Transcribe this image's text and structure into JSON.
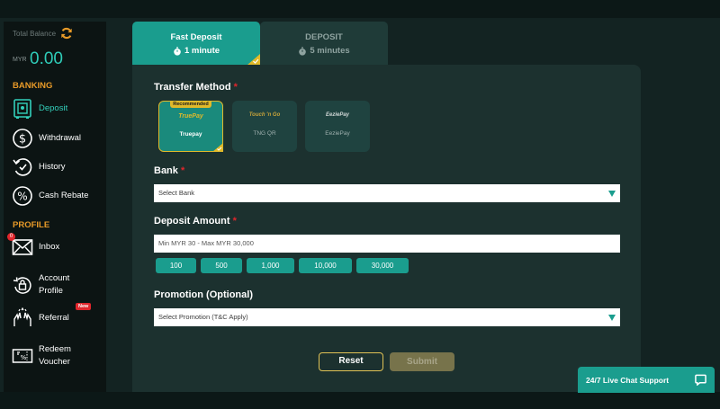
{
  "sidebar": {
    "balance_label": "Total Balance",
    "currency": "MYR",
    "balance": "0.00",
    "banking_title": "BANKING",
    "profile_title": "PROFILE",
    "items": [
      {
        "label": "Deposit",
        "icon": "safe-icon"
      },
      {
        "label": "Withdrawal",
        "icon": "dollar-icon"
      },
      {
        "label": "History",
        "icon": "history-icon"
      },
      {
        "label": "Cash Rebate",
        "icon": "percent-icon"
      },
      {
        "label": "Inbox",
        "icon": "mail-icon",
        "badge": "0"
      },
      {
        "label": "Account Profile",
        "icon": "lock-icon"
      },
      {
        "label": "Referral",
        "icon": "hands-icon",
        "badge": "New"
      },
      {
        "label": "Redeem Voucher",
        "icon": "voucher-icon"
      }
    ]
  },
  "tabs": [
    {
      "name": "Fast Deposit",
      "time": "1 minute"
    },
    {
      "name": "DEPOSIT",
      "time": "5 minutes"
    }
  ],
  "form": {
    "transfer_method_label": "Transfer Method",
    "recommended": "Recommended",
    "methods": [
      {
        "logo": "TruePay",
        "name": "Truepay"
      },
      {
        "logo": "Touch 'n Go",
        "name": "TNG QR"
      },
      {
        "logo": "EeziePay",
        "name": "EeziePay"
      }
    ],
    "bank_label": "Bank",
    "bank_placeholder": "Select Bank",
    "amount_label": "Deposit Amount",
    "amount_placeholder": "Min MYR 30 - Max MYR 30,000",
    "amounts": [
      "100",
      "500",
      "1,000",
      "10,000",
      "30,000"
    ],
    "promotion_label": "Promotion (Optional)",
    "promotion_placeholder": "Select Promotion (T&C Apply)",
    "reset": "Reset",
    "submit": "Submit"
  },
  "chat": {
    "label": "24/7 Live Chat Support"
  },
  "colors": {
    "accent": "#1a9d8e",
    "highlight": "#e0b92a",
    "balance": "#2fcdb9",
    "section": "#e89a28"
  }
}
